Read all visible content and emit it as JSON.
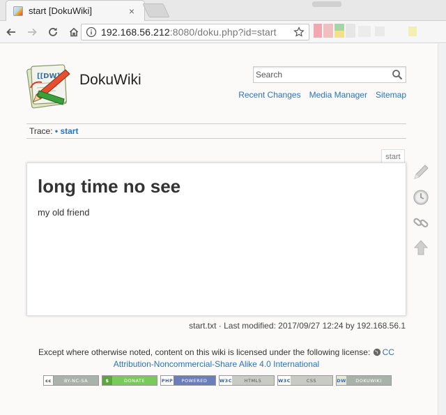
{
  "browser": {
    "tab_title": "start [DokuWiki]",
    "tab_close": "×",
    "url_host": "192.168.56.212",
    "url_rest": ":8080/doku.php?id=start"
  },
  "site": {
    "title": "DokuWiki",
    "logo_text": "[[DW]]",
    "search_placeholder": "Search",
    "nav": [
      "Recent Changes",
      "Media Manager",
      "Sitemap"
    ]
  },
  "breadcrumb": {
    "label": "Trace:",
    "crumb": "start"
  },
  "page": {
    "tab_label": "start",
    "heading": "long time no see",
    "body": "my old friend"
  },
  "docinfo": "start.txt · Last modified: 2017/09/27 12:24 by 192.168.56.1",
  "license": {
    "prefix": "Except where otherwise noted, content on this wiki is licensed under the following license:",
    "link_part1": "CC",
    "link_part2": "Attribution-Noncommercial-Share Alike 4.0 International"
  },
  "badges": [
    {
      "left": "cc",
      "text": "BY-NC-SA",
      "color": "#aab2ab"
    },
    {
      "left": "$",
      "text": "DONATE",
      "color": "#79c95b"
    },
    {
      "left": "PHP",
      "text": "POWERED",
      "color": "#6b7eb9"
    },
    {
      "left": "W3C",
      "text": "HTML5",
      "color": "#c8cbc3"
    },
    {
      "left": "W3C",
      "text": "CSS",
      "color": "#c8cbc3"
    },
    {
      "left": "DW",
      "text": "DOKUWIKI",
      "color": "#a9b2a9"
    }
  ]
}
